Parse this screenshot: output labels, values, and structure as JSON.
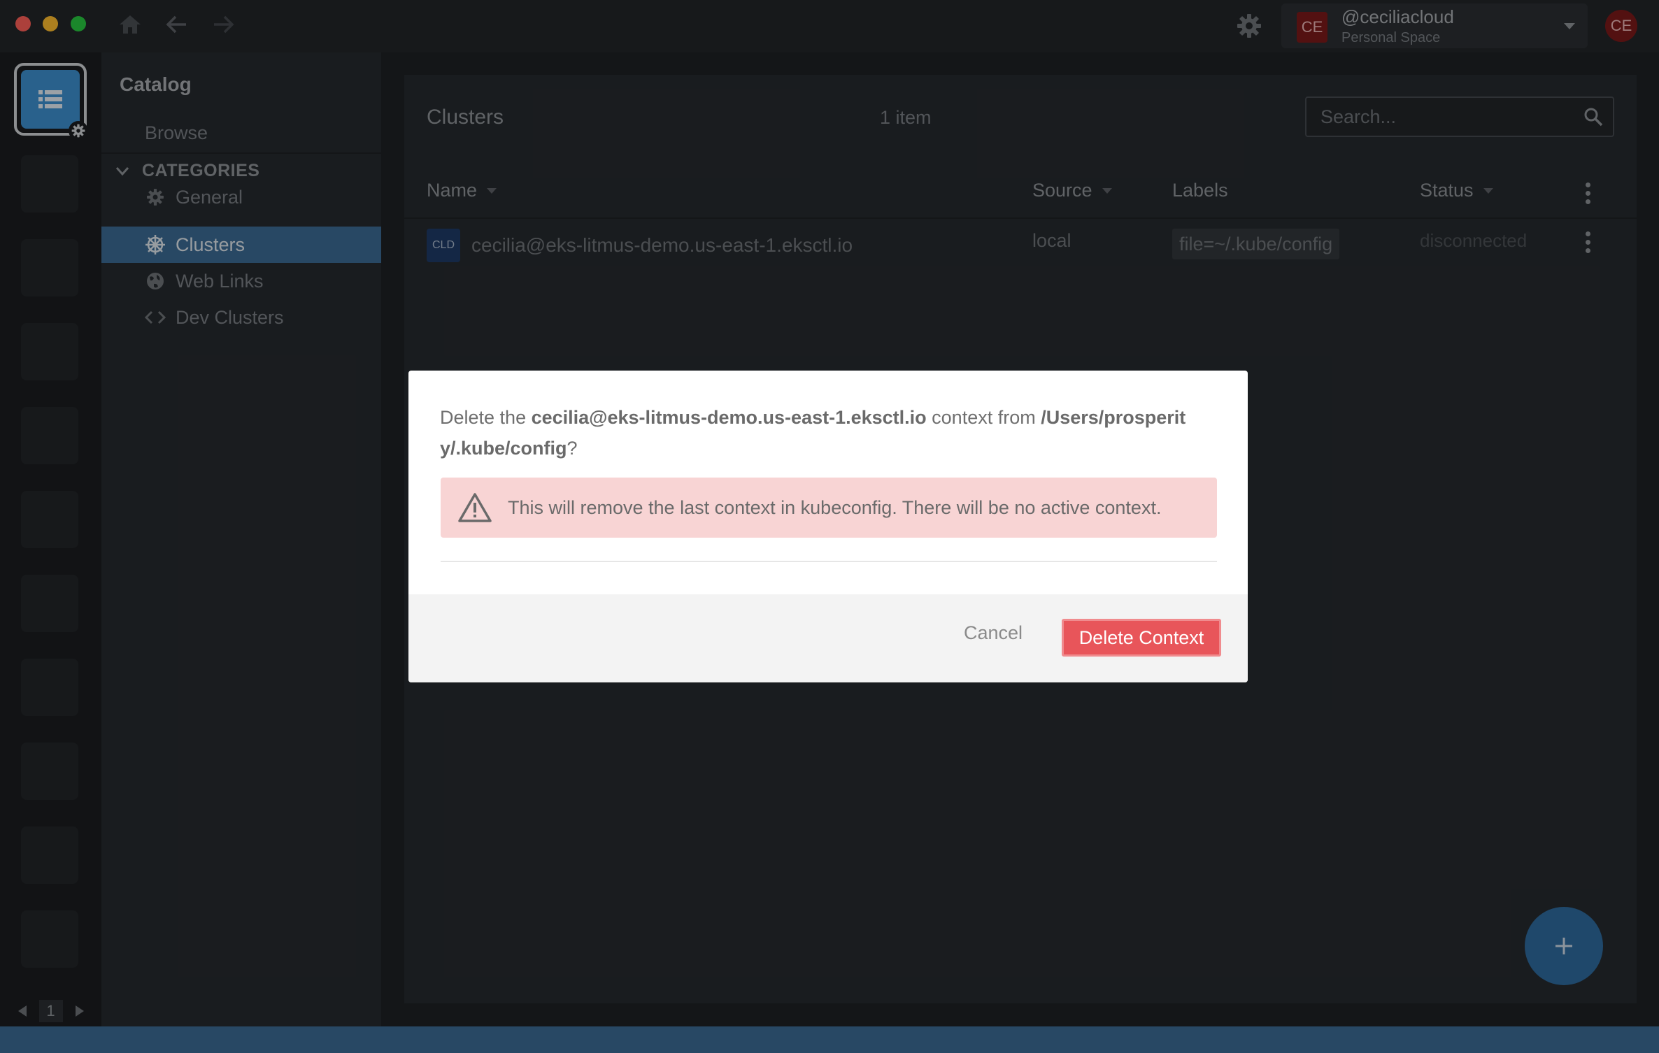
{
  "titlebar": {
    "user": {
      "name": "@ceciliacloud",
      "space": "Personal Space",
      "initials": "CE"
    },
    "avatar_initials": "CE"
  },
  "hotbar": {
    "page": "1"
  },
  "sidebar": {
    "title": "Catalog",
    "browse": "Browse",
    "categories_label": "CATEGORIES",
    "items": [
      {
        "label": "General",
        "icon": "gear-icon"
      },
      {
        "label": "Clusters",
        "icon": "helm-icon",
        "active": true
      },
      {
        "label": "Web Links",
        "icon": "globe-icon"
      },
      {
        "label": "Dev Clusters",
        "icon": "code-icon"
      }
    ]
  },
  "main": {
    "title": "Clusters",
    "count": "1 item",
    "search": {
      "placeholder": "Search..."
    },
    "columns": {
      "name": "Name",
      "source": "Source",
      "labels": "Labels",
      "status": "Status"
    },
    "rows": [
      {
        "badge": "CLD",
        "name": "cecilia@eks-litmus-demo.us-east-1.eksctl.io",
        "source": "local",
        "label": "file=~/.kube/config",
        "status": "disconnected"
      }
    ]
  },
  "dialog": {
    "prefix": "Delete the ",
    "context": "cecilia@eks-litmus-demo.us-east-1.eksctl.io",
    "middle": " context from ",
    "path_line1": "/Users/prosperit",
    "path_line2": "y/.kube/config",
    "suffix": "?",
    "warning": "This will remove the last context in kubeconfig. There will be no active context.",
    "cancel_label": "Cancel",
    "confirm_label": "Delete Context"
  },
  "colors": {
    "accent": "#3c6b94",
    "danger": "#e8555a",
    "warning_bg": "#f8d4d4"
  }
}
